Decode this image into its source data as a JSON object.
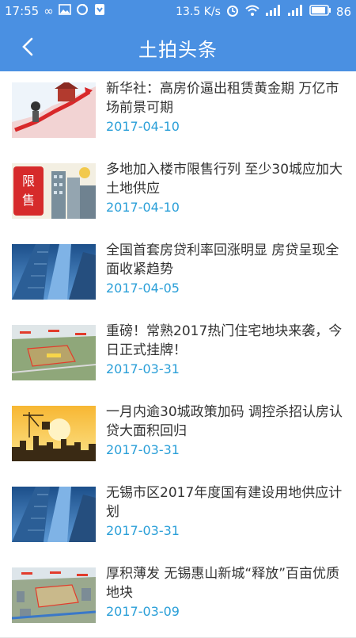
{
  "status_bar": {
    "time": "17:55",
    "net_speed": "13.5 K/s",
    "battery": "86",
    "icons": [
      "infinity-icon",
      "image-icon",
      "sync-icon",
      "shield-icon",
      "alarm-icon",
      "wifi-icon",
      "signal-icon",
      "signal-icon",
      "battery-icon"
    ]
  },
  "app_bar": {
    "title": "土拍头条",
    "back_icon": "chevron-left-icon"
  },
  "articles": [
    {
      "headline": "新华社：高房价逼出租赁黄金期 万亿市场前景可期",
      "date": "2017-04-10",
      "thumb": "rising-chart-illustration"
    },
    {
      "headline": "多地加入楼市限售行列 至少30城应加大土地供应",
      "date": "2017-04-10",
      "thumb": "restricted-sale-illustration"
    },
    {
      "headline": "全国首套房贷利率回涨明显 房贷呈现全面收紧趋势",
      "date": "2017-04-05",
      "thumb": "skyscrapers-photo"
    },
    {
      "headline": "重磅！常熟2017热门住宅地块来袭，今日正式挂牌！",
      "date": "2017-03-31",
      "thumb": "land-aerial-photo"
    },
    {
      "headline": "一月内逾30城政策加码 调控杀招认房认贷大面积回归",
      "date": "2017-03-31",
      "thumb": "sunset-city-illustration"
    },
    {
      "headline": "无锡市区2017年度国有建设用地供应计划",
      "date": "2017-03-31",
      "thumb": "skyscrapers-photo"
    },
    {
      "headline": "厚积薄发 无锡惠山新城“释放”百亩优质地块",
      "date": "2017-03-09",
      "thumb": "district-aerial-photo"
    }
  ]
}
